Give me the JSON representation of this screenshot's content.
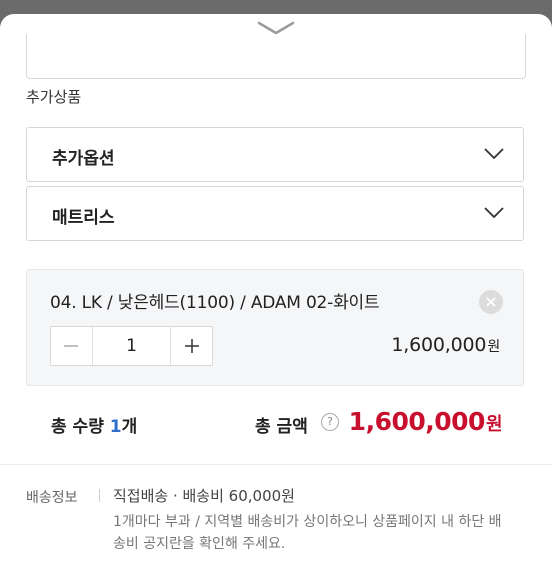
{
  "additional_products": {
    "section_label": "추가상품",
    "selects": [
      {
        "label": "추가옵션",
        "icon": "chevron-down-icon"
      },
      {
        "label": "매트리스",
        "icon": "chevron-down-icon"
      }
    ]
  },
  "selected_item": {
    "title": "04. LK / 낮은헤드(1100) / ADAM 02-화이트",
    "quantity": "1",
    "price": "1,600,000",
    "price_unit": "원"
  },
  "totals": {
    "quantity_label": "총 수량",
    "quantity_value": "1",
    "quantity_unit": "개",
    "amount_label": "총 금액",
    "help_symbol": "?",
    "amount_value": "1,600,000",
    "amount_unit": "원",
    "accent_color": "#c8102e"
  },
  "shipping": {
    "label": "배송정보",
    "method": "직접배송 · 배송비 60,000원",
    "note": "1개마다 부과 / 지역별 배송비가 상이하오니 상품페이지 내 하단 배송비 공지란을 확인해 주세요."
  }
}
